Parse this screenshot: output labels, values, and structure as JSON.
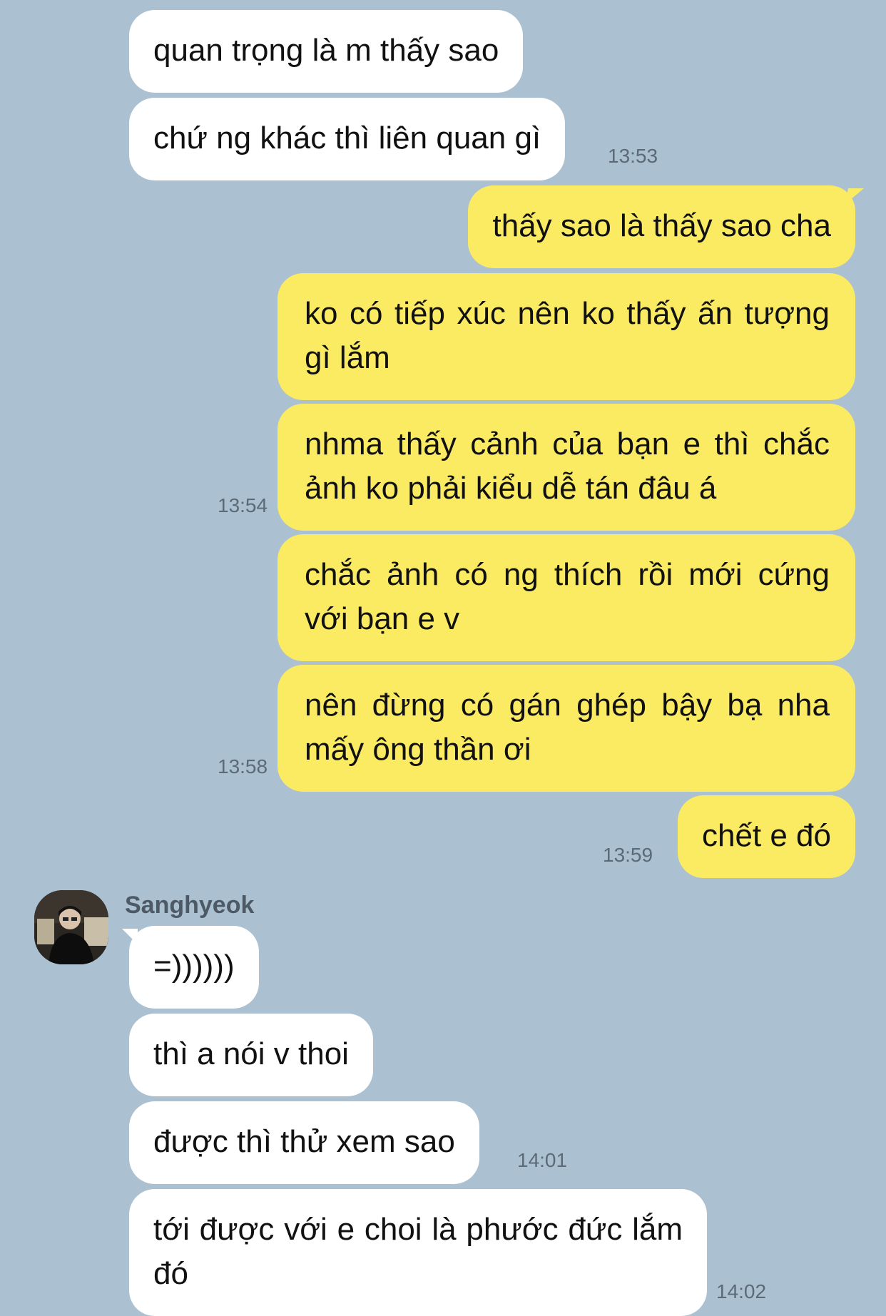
{
  "contact": {
    "name": "Sanghyeok",
    "avatar_icon": "profile-photo-icon"
  },
  "messages": [
    {
      "side": "in",
      "text": "quan trọng là m thấy sao"
    },
    {
      "side": "in",
      "text": "chứ ng khác thì liên quan gì",
      "time": "13:53"
    },
    {
      "side": "out",
      "text": "thấy sao là thấy sao cha"
    },
    {
      "side": "out",
      "text": "ko có tiếp xúc nên ko thấy ấn tượng gì lắm"
    },
    {
      "side": "out",
      "text": "nhma thấy cảnh của bạn e thì chắc ảnh ko phải kiểu dễ tán đâu á",
      "time": "13:54"
    },
    {
      "side": "out",
      "text": "chắc ảnh có ng thích rồi mới cứng với bạn e v"
    },
    {
      "side": "out",
      "text": "nên đừng có gán ghép bậy bạ nha mấy ông thần ơi",
      "time": "13:58"
    },
    {
      "side": "out",
      "text": "chết e đó",
      "time": "13:59"
    },
    {
      "side": "in",
      "text": "=))))))"
    },
    {
      "side": "in",
      "text": "thì a nói v thoi"
    },
    {
      "side": "in",
      "text": "được thì thử xem sao",
      "time": "14:01"
    },
    {
      "side": "in",
      "text": "tới được với e choi là phước đức lắm đó",
      "time": "14:02"
    }
  ],
  "colors": {
    "background": "#abc1d1",
    "incoming": "#ffffff",
    "outgoing": "#fbeb63"
  }
}
